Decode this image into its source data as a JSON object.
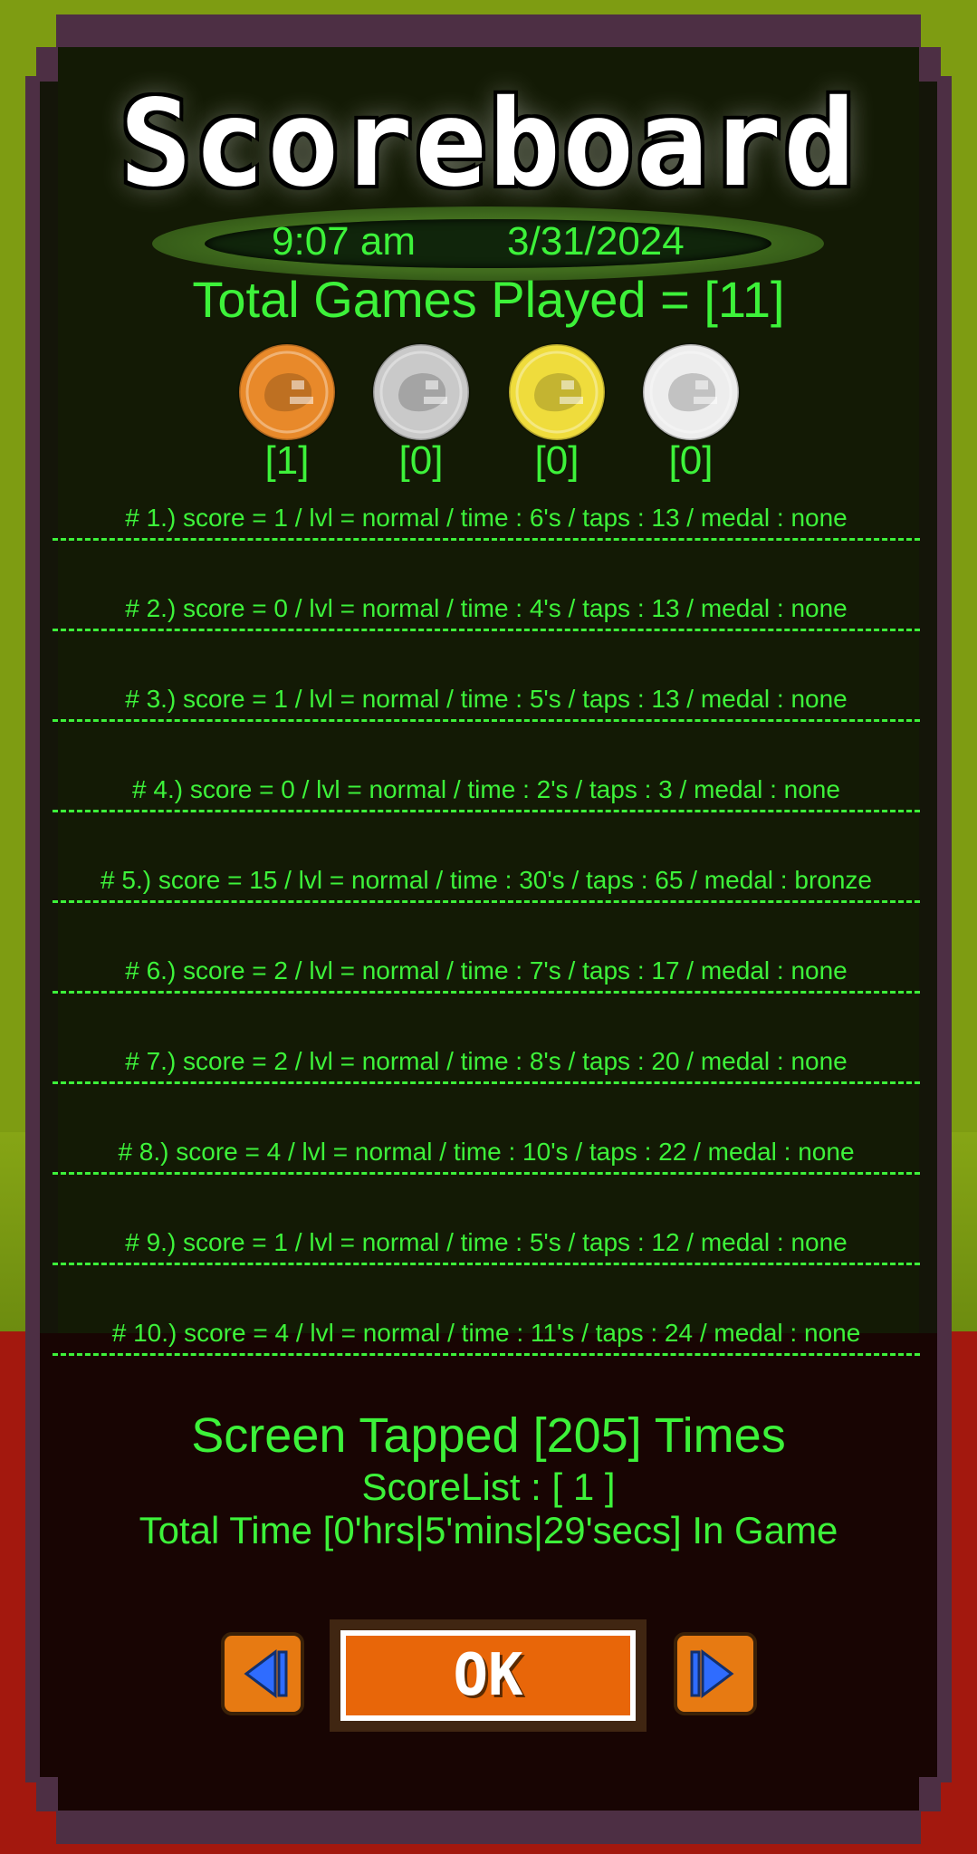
{
  "title": "Scoreboard",
  "datetime": {
    "time": "9:07 am",
    "date": "3/31/2024"
  },
  "total_games": "Total Games Played = [11]",
  "medals": [
    {
      "name": "bronze",
      "count": "[1]",
      "color": "#e8892a"
    },
    {
      "name": "silver",
      "count": "[0]",
      "color": "#c9c9c9"
    },
    {
      "name": "gold",
      "count": "[0]",
      "color": "#efdc3c"
    },
    {
      "name": "platinum",
      "count": "[0]",
      "color": "#ededed"
    }
  ],
  "scores": [
    "# 1.) score = 1 / lvl = normal / time : 6's / taps : 13 / medal : none",
    "# 2.) score = 0 / lvl = normal / time : 4's / taps : 13 / medal : none",
    "# 3.) score = 1 / lvl = normal / time : 5's / taps : 13 / medal : none",
    "# 4.) score = 0 / lvl = normal / time : 2's / taps : 3 / medal : none",
    "# 5.) score = 15 / lvl = normal / time : 30's / taps : 65 / medal : bronze",
    "# 6.) score = 2 / lvl = normal / time : 7's / taps : 17 / medal : none",
    "# 7.) score = 2 / lvl = normal / time : 8's / taps : 20 / medal : none",
    "# 8.) score = 4 / lvl = normal / time : 10's / taps : 22 / medal : none",
    "# 9.) score = 1 / lvl = normal / time : 5's / taps : 12 / medal : none",
    "# 10.) score = 4 / lvl = normal / time : 11's / taps : 24 / medal : none"
  ],
  "stats": {
    "taps": "Screen Tapped [205] Times",
    "scorelist": "ScoreList : [ 1 ]",
    "total_time": "Total Time [0'hrs|5'mins|29'secs] In Game"
  },
  "buttons": {
    "prev": "prev-arrow-icon",
    "ok": "OK",
    "next": "next-arrow-icon"
  },
  "colors": {
    "text": "#3df23a",
    "ok_button": "#e86609",
    "arrow_button": "#e77a12",
    "arrow_icon": "#2f6cff"
  }
}
